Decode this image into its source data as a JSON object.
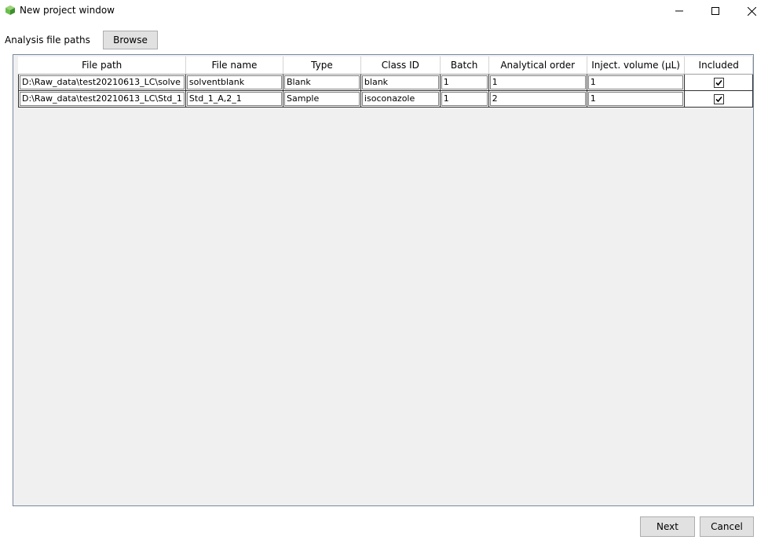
{
  "window": {
    "title": "New project window"
  },
  "toolbar": {
    "paths_label": "Analysis file paths",
    "browse_label": "Browse"
  },
  "grid": {
    "columns": [
      "File path",
      "File name",
      "Type",
      "Class ID",
      "Batch",
      "Analytical order",
      "Inject. volume (µL)",
      "Included"
    ],
    "rows": [
      {
        "file_path": "D:\\Raw_data\\test20210613_LC\\solve",
        "file_name": "solventblank",
        "type": "Blank",
        "class_id": "blank",
        "batch": "1",
        "order": "1",
        "volume": "1",
        "included": true
      },
      {
        "file_path": "D:\\Raw_data\\test20210613_LC\\Std_1",
        "file_name": "Std_1_A,2_1",
        "type": "Sample",
        "class_id": "isoconazole",
        "batch": "1",
        "order": "2",
        "volume": "1",
        "included": true
      }
    ]
  },
  "footer": {
    "next_label": "Next",
    "cancel_label": "Cancel"
  },
  "colors": {
    "app_icon_green": "#4caf50",
    "grid_background": "#f0f0f0"
  }
}
